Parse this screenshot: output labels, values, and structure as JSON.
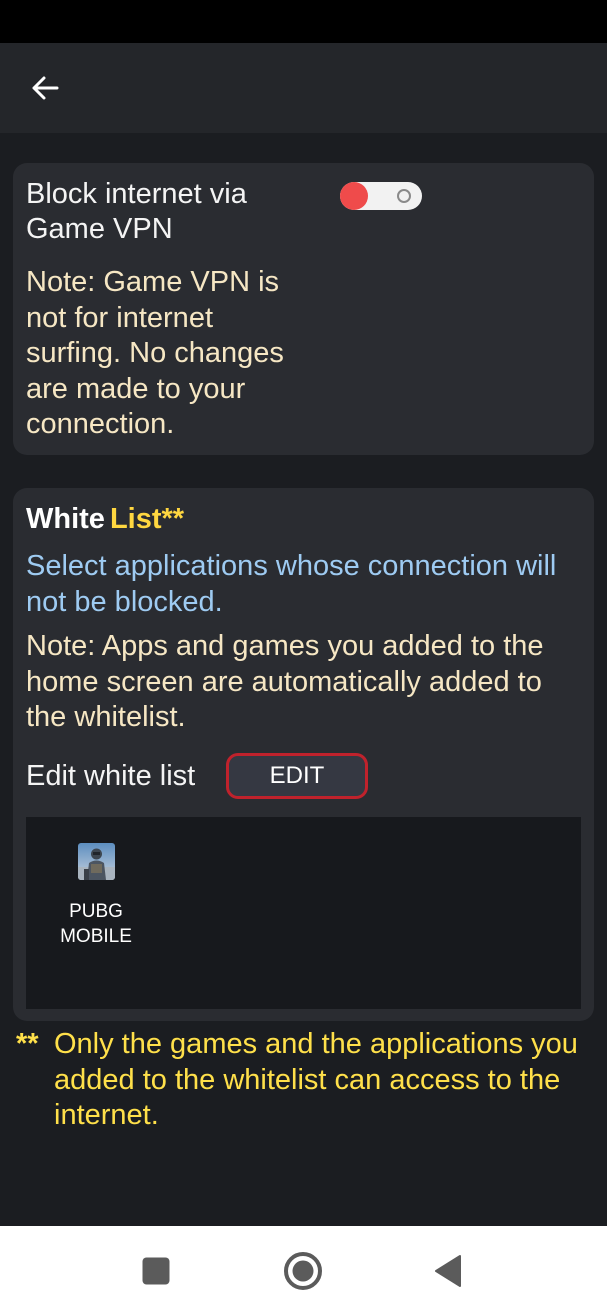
{
  "vpn_card": {
    "title": "Block internet via Game VPN",
    "note": "Note: Game VPN is not for internet surfing. No changes are made to your connection.",
    "toggle": {
      "state": "off",
      "accent": "#ef4b4b"
    }
  },
  "whitelist_card": {
    "title_white": "White",
    "title_list": "List**",
    "description": "Select applications whose connection will not be blocked.",
    "note": "Note: Apps and games you added to the home screen are automatically added to the whitelist.",
    "edit_label": "Edit white list",
    "edit_button": "EDIT",
    "apps": [
      {
        "name": "PUBG MOBILE",
        "icon": "pubg-mobile-icon"
      }
    ]
  },
  "footnote": {
    "stars": "**",
    "text": "Only the games and the applications you added to the whitelist can access to the internet."
  },
  "colors": {
    "accent_yellow": "#ffd740",
    "link_blue": "#9ecbf2",
    "edit_border": "#c0222c",
    "background": "#1b1d21",
    "card": "#2a2c31"
  },
  "nav": {
    "icons": [
      "recents-square-icon",
      "home-circle-icon",
      "back-triangle-icon"
    ]
  }
}
